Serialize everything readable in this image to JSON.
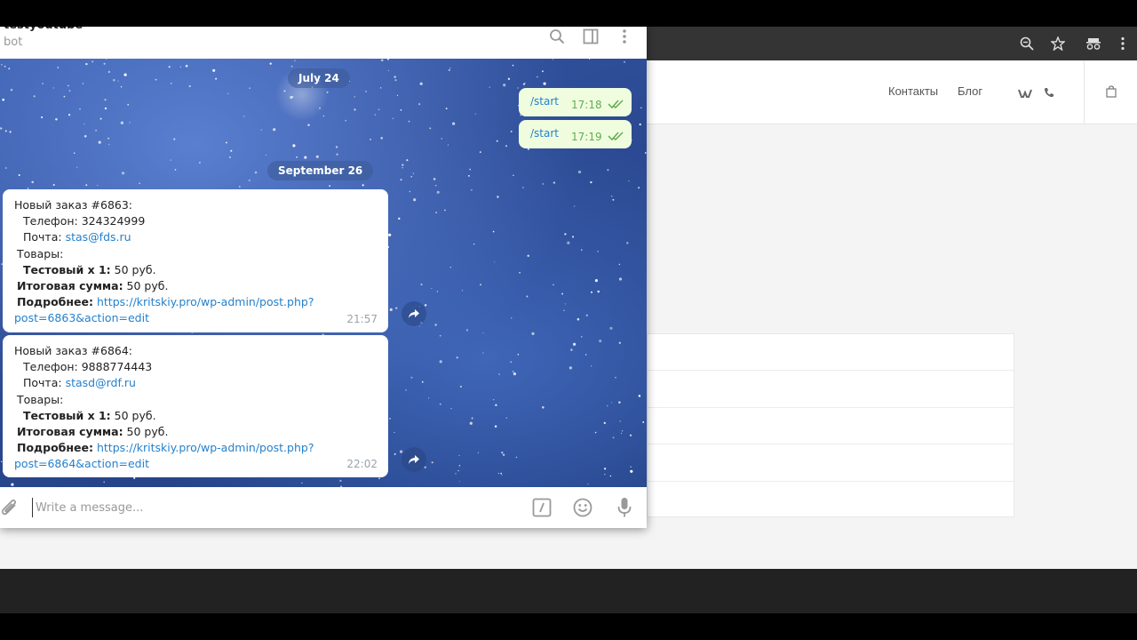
{
  "chat": {
    "name": "testyoutube",
    "status": "bot"
  },
  "site": {
    "nav": [
      "Контакты",
      "Блог"
    ]
  },
  "dates": [
    "July 24",
    "September 26"
  ],
  "outgoing": [
    {
      "text": "/start",
      "time": "17:18"
    },
    {
      "text": "/start",
      "time": "17:19"
    }
  ],
  "orders": [
    {
      "title": "Новый заказ #6863:",
      "phone_label": "Телефон:",
      "phone": "324324999",
      "email_label": "Почта:",
      "email": "stas@fds.ru",
      "goods_label": "Товары:",
      "item_name": "Тестовый x 1:",
      "item_price": "50 руб.",
      "total_label": "Итоговая сумма:",
      "total": "50 руб.",
      "more_label": "Подробнее:",
      "link_part1": "https://kritskiy.pro/wp-admin/post.php?",
      "link_part2": "post=6863&action=edit",
      "time": "21:57"
    },
    {
      "title": "Новый заказ #6864:",
      "phone_label": "Телефон:",
      "phone": "9888774443",
      "email_label": "Почта:",
      "email": "stasd@rdf.ru",
      "goods_label": "Товары:",
      "item_name": "Тестовый x 1:",
      "item_price": "50 руб.",
      "total_label": "Итоговая сумма:",
      "total": "50 руб.",
      "more_label": "Подробнее:",
      "link_part1": "https://kritskiy.pro/wp-admin/post.php?",
      "link_part2": "post=6864&action=edit",
      "time": "22:02"
    }
  ],
  "input": {
    "placeholder": "Write a message..."
  },
  "icons": {
    "header": [
      "search-icon",
      "sidebar-toggle-icon",
      "more-vertical-icon"
    ],
    "input": [
      "attach-icon",
      "commands-icon",
      "emoji-icon",
      "microphone-icon"
    ],
    "browser": [
      "zoom-icon",
      "bookmark-star-icon",
      "incognito-icon",
      "browser-menu-icon"
    ],
    "site": [
      "vk-icon",
      "phone-icon",
      "cart-icon"
    ]
  },
  "colors": {
    "out_bubble": "#effdde",
    "link": "#2481cc",
    "check": "#62ac55"
  }
}
